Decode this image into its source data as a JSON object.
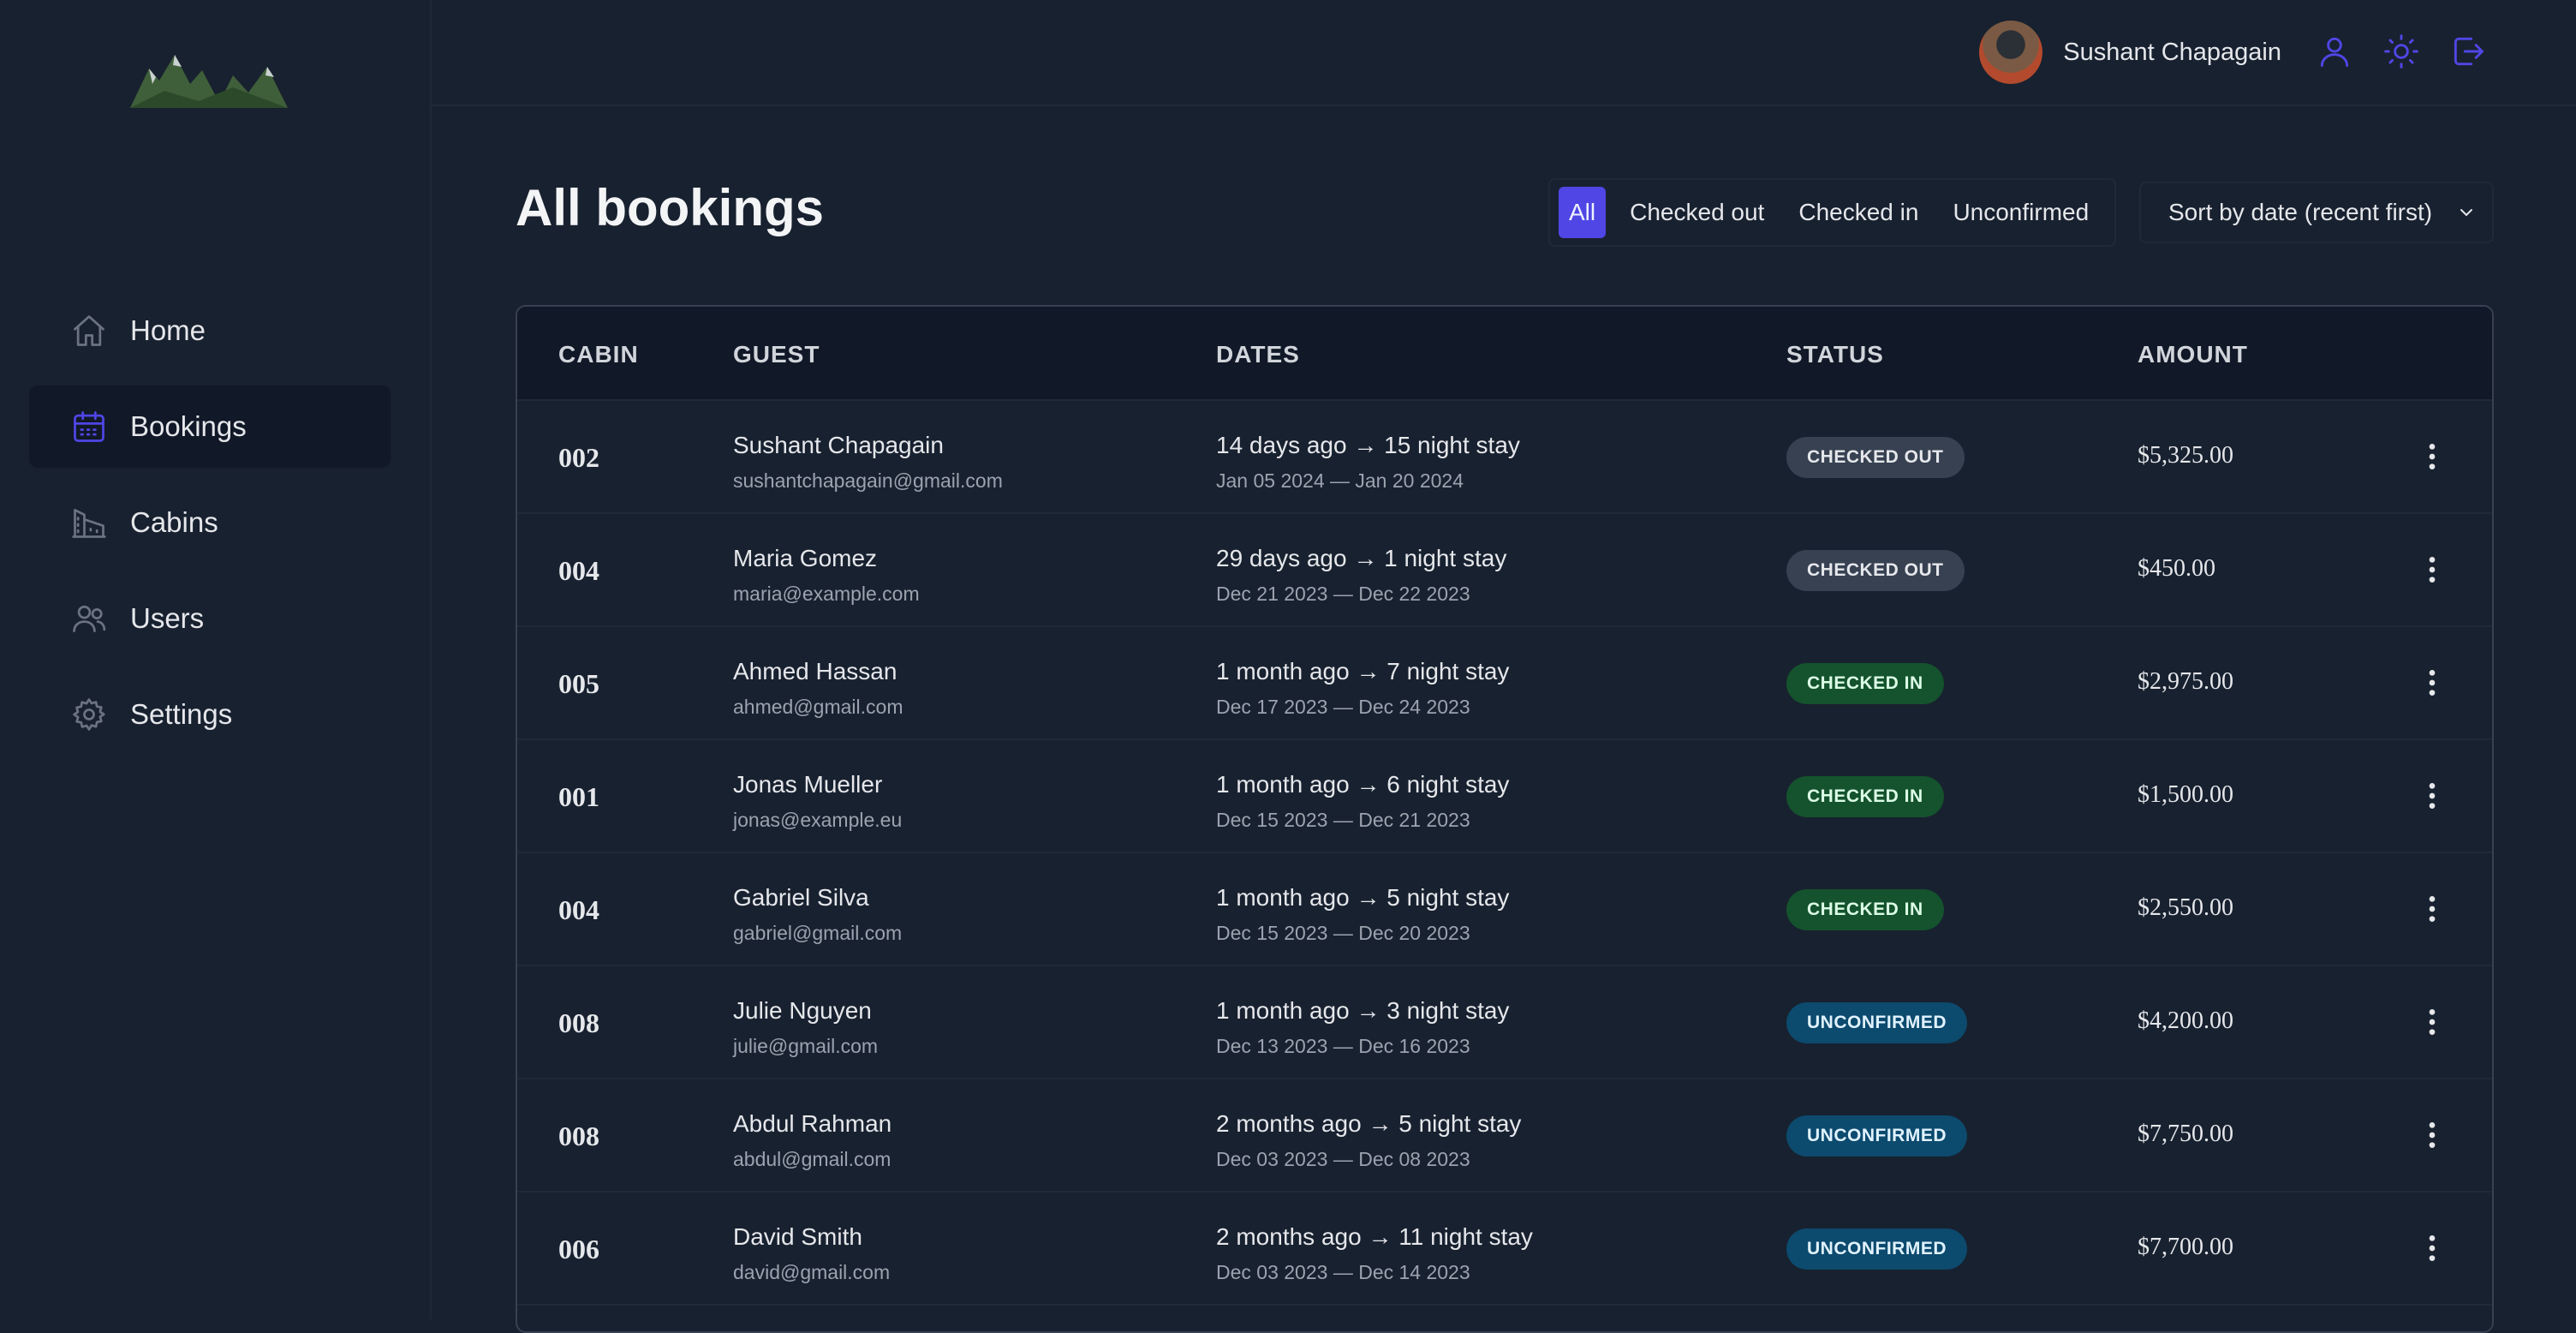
{
  "header": {
    "user_name": "Sushant Chapagain",
    "icons": [
      "user-icon",
      "sun-icon",
      "logout-icon"
    ]
  },
  "sidebar": {
    "items": [
      {
        "label": "Home",
        "icon": "home-icon",
        "active": false
      },
      {
        "label": "Bookings",
        "icon": "calendar-icon",
        "active": true
      },
      {
        "label": "Cabins",
        "icon": "cabin-icon",
        "active": false
      },
      {
        "label": "Users",
        "icon": "users-icon",
        "active": false
      },
      {
        "label": "Settings",
        "icon": "gear-icon",
        "active": false
      }
    ]
  },
  "main": {
    "title": "All bookings",
    "filters": [
      "All",
      "Checked out",
      "Checked in",
      "Unconfirmed"
    ],
    "active_filter": "All",
    "sort_label": "Sort by date (recent first)"
  },
  "table": {
    "columns": [
      "CABIN",
      "GUEST",
      "DATES",
      "STATUS",
      "AMOUNT"
    ],
    "rows": [
      {
        "cabin": "002",
        "name": "Sushant Chapagain",
        "email": "sushantchapagain@gmail.com",
        "dates": "14 days ago → 15 night stay",
        "range": "Jan 05 2024 — Jan 20 2024",
        "status": "CHECKED OUT",
        "amount": "$5,325.00"
      },
      {
        "cabin": "004",
        "name": "Maria Gomez",
        "email": "maria@example.com",
        "dates": "29 days ago → 1 night stay",
        "range": "Dec 21 2023 — Dec 22 2023",
        "status": "CHECKED OUT",
        "amount": "$450.00"
      },
      {
        "cabin": "005",
        "name": "Ahmed Hassan",
        "email": "ahmed@gmail.com",
        "dates": "1 month ago → 7 night stay",
        "range": "Dec 17 2023 — Dec 24 2023",
        "status": "CHECKED IN",
        "amount": "$2,975.00"
      },
      {
        "cabin": "001",
        "name": "Jonas Mueller",
        "email": "jonas@example.eu",
        "dates": "1 month ago → 6 night stay",
        "range": "Dec 15 2023 — Dec 21 2023",
        "status": "CHECKED IN",
        "amount": "$1,500.00"
      },
      {
        "cabin": "004",
        "name": "Gabriel Silva",
        "email": "gabriel@gmail.com",
        "dates": "1 month ago → 5 night stay",
        "range": "Dec 15 2023 — Dec 20 2023",
        "status": "CHECKED IN",
        "amount": "$2,550.00"
      },
      {
        "cabin": "008",
        "name": "Julie Nguyen",
        "email": "julie@gmail.com",
        "dates": "1 month ago → 3 night stay",
        "range": "Dec 13 2023 — Dec 16 2023",
        "status": "UNCONFIRMED",
        "amount": "$4,200.00"
      },
      {
        "cabin": "008",
        "name": "Abdul Rahman",
        "email": "abdul@gmail.com",
        "dates": "2 months ago → 5 night stay",
        "range": "Dec 03 2023 — Dec 08 2023",
        "status": "UNCONFIRMED",
        "amount": "$7,750.00"
      },
      {
        "cabin": "006",
        "name": "David Smith",
        "email": "david@gmail.com",
        "dates": "2 months ago → 11 night stay",
        "range": "Dec 03 2023 — Dec 14 2023",
        "status": "UNCONFIRMED",
        "amount": "$7,700.00"
      }
    ]
  },
  "colors": {
    "background": "#18212f",
    "accent": "#4f46e5",
    "checked_out": "#374151",
    "checked_in": "#14532d",
    "unconfirmed": "#0c4a6e"
  }
}
